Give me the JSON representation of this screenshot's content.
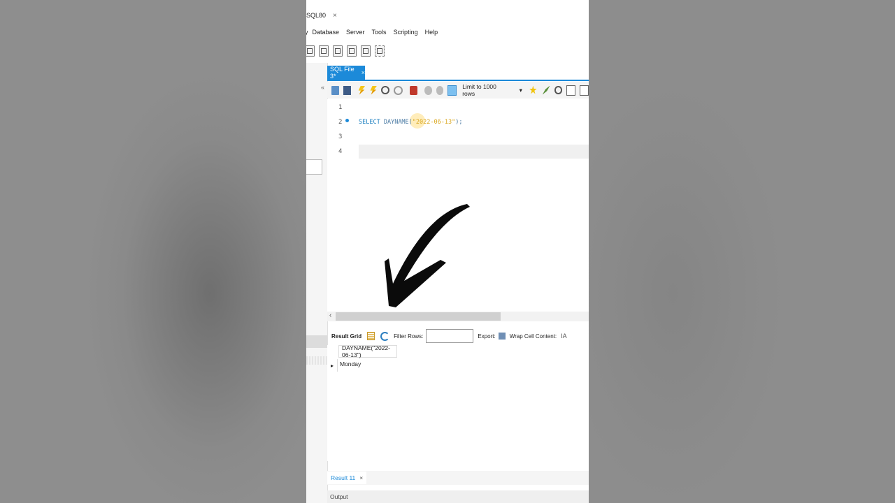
{
  "connection_tab": {
    "label": "SQL80",
    "close": "×"
  },
  "menu": {
    "items": [
      "y",
      "Database",
      "Server",
      "Tools",
      "Scripting",
      "Help"
    ]
  },
  "document_tab": {
    "label": "SQL File 3*",
    "close": "×"
  },
  "editor_toolbar": {
    "limit_label": "Limit to 1000 rows",
    "limit_caret": "▾"
  },
  "editor": {
    "line_numbers": [
      "1",
      "2",
      "3",
      "4"
    ],
    "code": {
      "keyword": "SELECT",
      "function": "DAYNAME",
      "open": "(",
      "string": "\"2022-06-13\"",
      "close": ");"
    }
  },
  "result_toolbar": {
    "result_grid": "Result Grid",
    "filter_rows": "Filter Rows:",
    "filter_value": "",
    "export": "Export:",
    "wrap_cell": "Wrap Cell Content:",
    "wrap_icon": "IA"
  },
  "results": {
    "columns": [
      "DAYNAME(\"2022-06-13\")"
    ],
    "rows": [
      [
        "Monday"
      ]
    ]
  },
  "bottom_tabs": {
    "result_tab": "Result 11",
    "close": "×"
  },
  "output": {
    "label": "Output"
  },
  "icons": {
    "scroll_left": "‹",
    "row_pointer": "▸",
    "sidebar_collapse": "«",
    "pilcrow": "¶"
  },
  "colors": {
    "accent": "#1c8ad9",
    "keyword": "#1b7fc0",
    "string": "#d9a61d"
  }
}
